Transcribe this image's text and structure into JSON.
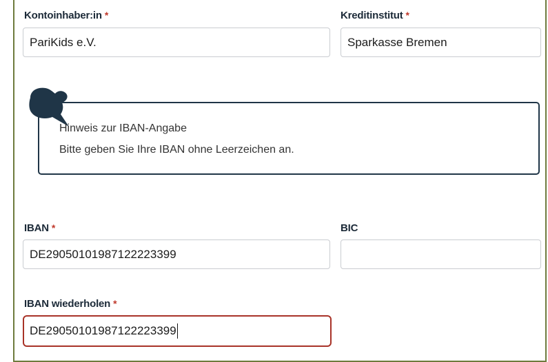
{
  "form": {
    "account_holder": {
      "label": "Kontoinhaber:in",
      "required_mark": "*",
      "value": "PariKids e.V."
    },
    "bank": {
      "label": "Kreditinstitut",
      "required_mark": "*",
      "value": "Sparkasse Bremen"
    },
    "hint": {
      "icon": "speech-bubble-icon",
      "title": "Hinweis zur IBAN-Angabe",
      "text": "Bitte geben Sie Ihre IBAN ohne Leerzeichen an."
    },
    "iban": {
      "label": "IBAN",
      "required_mark": "*",
      "value": "DE29050101987122223399"
    },
    "bic": {
      "label": "BIC",
      "value": ""
    },
    "iban_repeat": {
      "label": "IBAN wiederholen",
      "required_mark": "*",
      "value": "DE29050101987122223399"
    }
  },
  "colors": {
    "frame_border": "#6d7a3c",
    "hint_border": "#1f3547",
    "required": "#c0392b",
    "error_border": "#a83227"
  }
}
